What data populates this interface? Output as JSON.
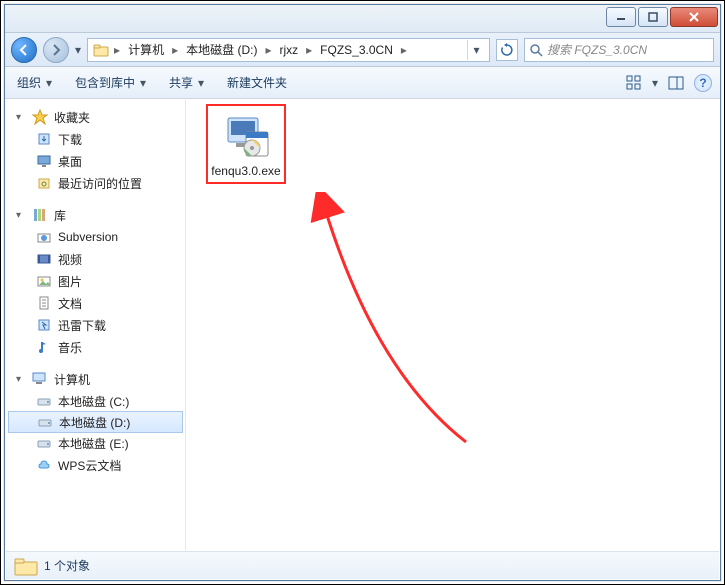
{
  "breadcrumb": {
    "items": [
      "计算机",
      "本地磁盘 (D:)",
      "rjxz",
      "FQZS_3.0CN"
    ]
  },
  "search": {
    "placeholder": "搜索 FQZS_3.0CN"
  },
  "toolbar": {
    "organize": "组织",
    "include": "包含到库中",
    "share": "共享",
    "newfolder": "新建文件夹"
  },
  "tree": {
    "favorites": {
      "label": "收藏夹",
      "children": [
        {
          "label": "下载"
        },
        {
          "label": "桌面"
        },
        {
          "label": "最近访问的位置"
        }
      ]
    },
    "libraries": {
      "label": "库",
      "children": [
        {
          "label": "Subversion"
        },
        {
          "label": "视频"
        },
        {
          "label": "图片"
        },
        {
          "label": "文档"
        },
        {
          "label": "迅雷下载"
        },
        {
          "label": "音乐"
        }
      ]
    },
    "computer": {
      "label": "计算机",
      "children": [
        {
          "label": "本地磁盘 (C:)"
        },
        {
          "label": "本地磁盘 (D:)",
          "selected": true
        },
        {
          "label": "本地磁盘 (E:)"
        },
        {
          "label": "WPS云文档"
        }
      ]
    }
  },
  "content": {
    "files": [
      {
        "name": "fenqu3.0.exe"
      }
    ]
  },
  "status": {
    "text": "1 个对象"
  }
}
